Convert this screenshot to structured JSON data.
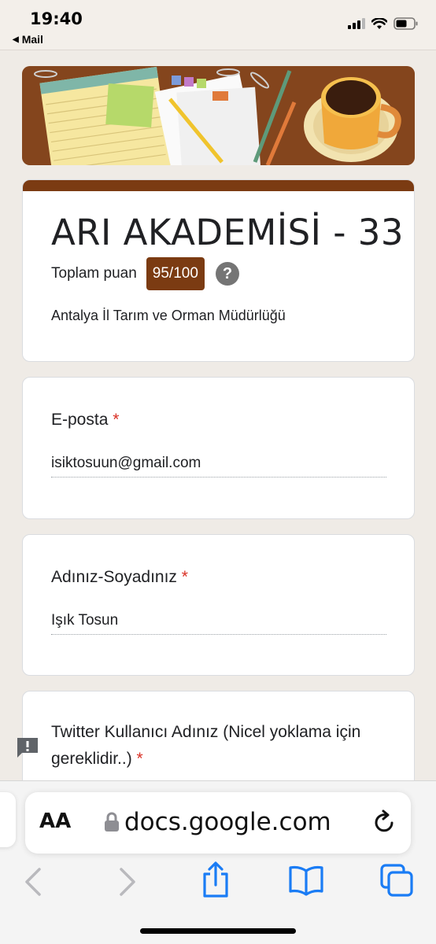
{
  "status_bar": {
    "time": "19:40",
    "back_app": "Mail"
  },
  "form": {
    "title": "ARI AKADEMİSİ - 33",
    "score_label": "Toplam puan",
    "score": "95/100",
    "description": "Antalya İl Tarım ve Orman Müdürlüğü",
    "accent_color": "#7b3b12"
  },
  "questions": [
    {
      "label": "E-posta",
      "required": "*",
      "answer": "isiktosuun@gmail.com"
    },
    {
      "label": "Adınız-Soyadınız",
      "required": "*",
      "answer": "Işık Tosun"
    },
    {
      "label": "Twitter Kullanıcı Adınız (Nicel yoklama için gereklidir..)",
      "required": "*"
    }
  ],
  "browser": {
    "text_size_label": "AA",
    "url": "docs.google.com"
  },
  "icons": [
    "signal-icon",
    "wifi-icon",
    "battery-icon",
    "help-icon",
    "feedback-icon",
    "lock-icon",
    "reload-icon",
    "back-icon",
    "forward-icon",
    "share-icon",
    "bookmarks-icon",
    "tabs-icon"
  ]
}
